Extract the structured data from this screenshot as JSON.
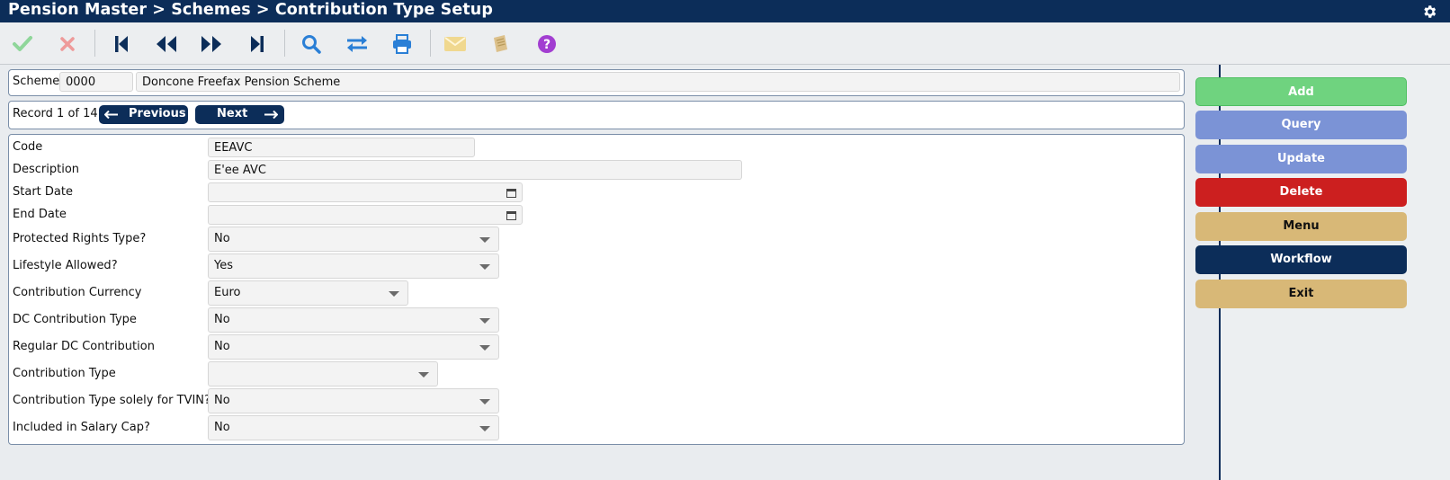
{
  "title": "Pension Master > Schemes > Contribution Type Setup",
  "colors": {
    "brand": "#0c2d59",
    "add": "#6fd37f",
    "query": "#7b93d6",
    "update": "#7b93d6",
    "delete": "#cc1f1f",
    "menu": "#d8b877",
    "workflow": "#0c2d59",
    "exit": "#d8b877"
  },
  "toolbar_icons": [
    "check-icon",
    "cross-icon",
    "first-record-icon",
    "previous-record-icon",
    "next-record-icon",
    "last-record-icon",
    "search-icon",
    "swap-icon",
    "print-icon",
    "mail-icon",
    "notebook-icon",
    "help-icon"
  ],
  "scheme": {
    "label": "Scheme",
    "code": "0000",
    "name": "Doncone Freefax Pension Scheme"
  },
  "record": {
    "text": "Record 1 of 14",
    "previous_label": "Previous",
    "next_label": "Next"
  },
  "form": {
    "code": {
      "label": "Code",
      "value": "EEAVC"
    },
    "description": {
      "label": "Description",
      "value": "E'ee AVC"
    },
    "start_date": {
      "label": "Start Date",
      "value": ""
    },
    "end_date": {
      "label": "End Date",
      "value": ""
    },
    "protected_rights": {
      "label": "Protected Rights Type?",
      "value": "No"
    },
    "lifestyle": {
      "label": "Lifestyle Allowed?",
      "value": "Yes"
    },
    "currency": {
      "label": "Contribution Currency",
      "value": "Euro"
    },
    "dc_type": {
      "label": "DC Contribution Type",
      "value": "No"
    },
    "regular_dc": {
      "label": "Regular DC Contribution",
      "value": "No"
    },
    "contribution_type": {
      "label": "Contribution Type",
      "value": ""
    },
    "tvin_only": {
      "label": "Contribution Type solely for TVIN?",
      "value": "No"
    },
    "salary_cap": {
      "label": "Included in Salary Cap?",
      "value": "No"
    }
  },
  "actions": {
    "add": "Add",
    "query": "Query",
    "update": "Update",
    "delete": "Delete",
    "menu": "Menu",
    "workflow": "Workflow",
    "exit": "Exit"
  }
}
